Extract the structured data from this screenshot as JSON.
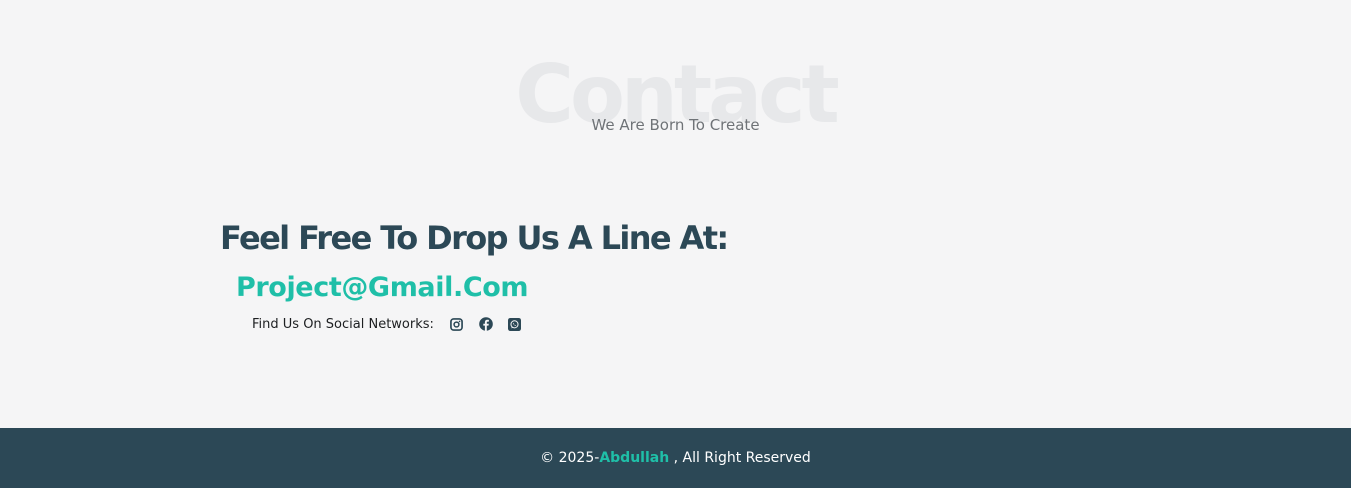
{
  "contact": {
    "bg_title": "Contact",
    "subtitle": "We Are Born To Create",
    "heading": "Feel Free To Drop Us A Line At:",
    "email": "Project@Gmail.Com",
    "social_label": "Find Us On Social Networks:",
    "social_icons": [
      "instagram-icon",
      "facebook-icon",
      "whatsapp-icon"
    ]
  },
  "footer": {
    "prefix": "© 2025-",
    "author": "Abdullah",
    "suffix": " , All Right Reserved"
  },
  "colors": {
    "background": "#f5f5f6",
    "heading": "#2c4856",
    "accent": "#1fbfa8",
    "footer_bg": "#2c4856"
  }
}
